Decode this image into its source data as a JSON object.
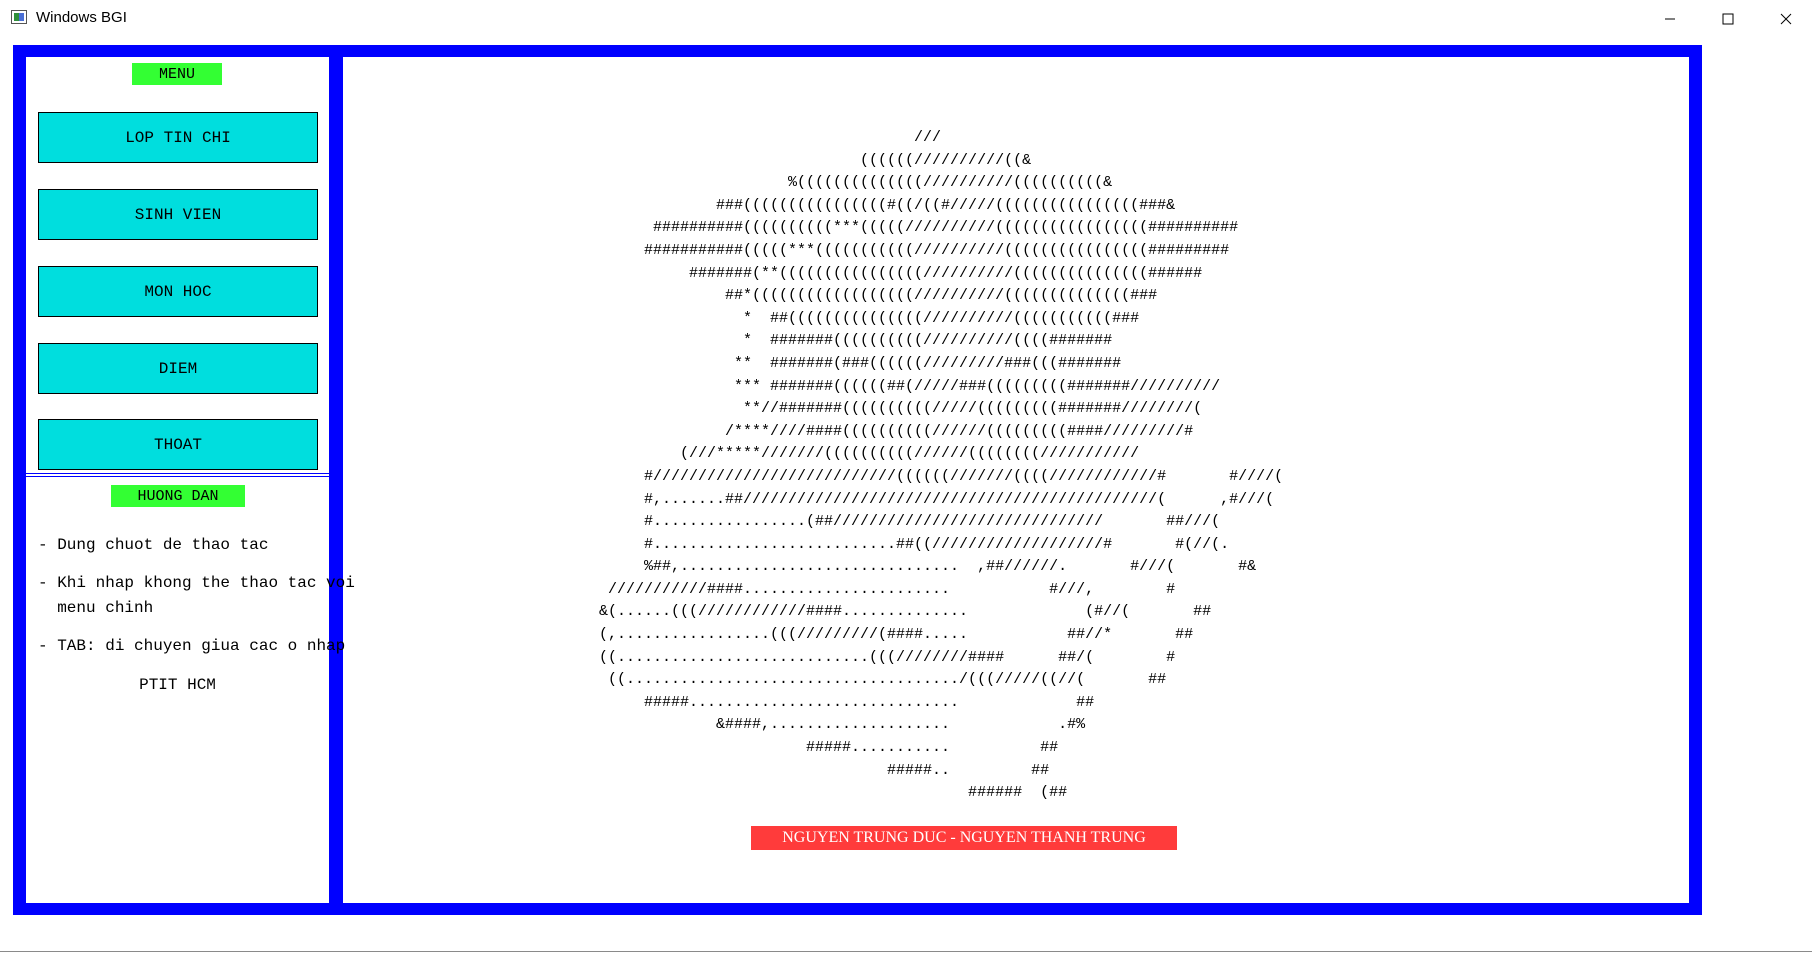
{
  "window": {
    "title": "Windows BGI",
    "icon": "bgi-app-icon",
    "controls": [
      "minimize-icon",
      "maximize-icon",
      "close-icon"
    ]
  },
  "colors": {
    "frame": "#0000ff",
    "menu_button": "#00dede",
    "title_badge": "#33ff33",
    "credit_badge": "#ff3b3b"
  },
  "menu": {
    "title": "MENU",
    "items": [
      "LOP TIN CHI",
      "SINH VIEN",
      "MON HOC",
      "DIEM",
      "THOAT"
    ]
  },
  "guide": {
    "title": "HUONG DAN",
    "lines": [
      "- Dung chuot de thao tac",
      "- Khi nhap khong the thao tac voi",
      "  menu chinh",
      "- TAB: di chuyen giua cac o nhap"
    ],
    "footer": "PTIT HCM"
  },
  "art": {
    "lines": [
      "                                    ///",
      "                              ((((((//////////((&",
      "                      %((((((((((((((//////////((((((((((&",
      "              ###((((((((((((((((#((/((#/////((((((((((((((((###&",
      "       ##########((((((((((***(((((//////////(((((((((((((((((##########",
      "      ###########(((((***(((((((((((//////////((((((((((((((((#########",
      "           #######(**((((((((((((((((//////////(((((((((((((((######",
      "               ##*((((((((((((((((((//////////((((((((((((((###",
      "                 *  ##(((((((((((((((//////////(((((((((((###",
      "                 *  #######((((((((((//////////((((#######",
      "                **  #######(###((((((/////////###(((#######",
      "                *** #######((((((##(/////###(((((((((#######//////////",
      "                 **//#######((((((((((/////(((((((((#######////////(",
      "               /****////####((((((((((//////(((((((((####/////////#",
      "          (///*****///////((((((((((//////((((((((///////////",
      "      #///////////////////////////((((((///////((((////////////#       #////(",
      "      #,.......##//////////////////////////////////////////////(      ,#///(",
      "      #.................(##//////////////////////////////       ##///(",
      "      #...........................##((///////////////////#       #(//(.",
      "      %##,...............................  ,##//////.       #///(       #&",
      "  ///////////####.......................           #///,        #",
      " &(......(((////////////####..............             (#//(       ##",
      " (,.................(((/////////(####.....           ##//*       ##",
      " ((............................(((////////####      ##/(        #",
      "  ((...................................../(((/////((//(       ##",
      "      #####..............................             ##",
      "              &####,....................            .#%",
      "                        #####...........          ##",
      "                                 #####..         ##",
      "                                          ######  (##"
    ]
  },
  "credits": "NGUYEN TRUNG DUC   -   NGUYEN THANH TRUNG"
}
